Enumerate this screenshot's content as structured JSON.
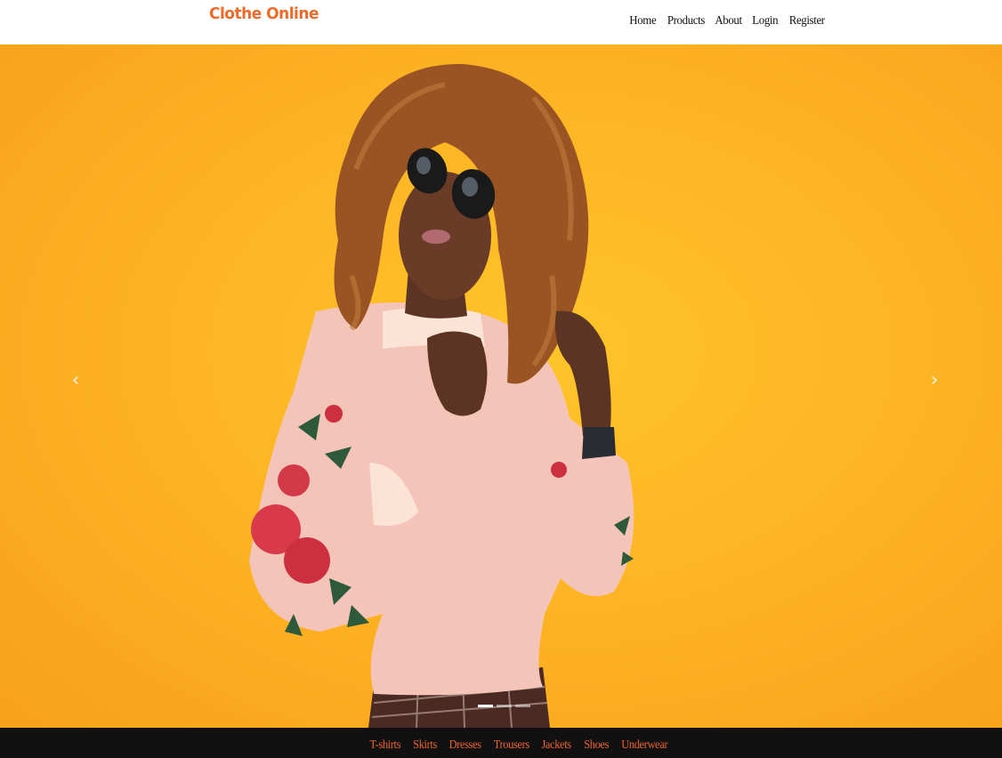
{
  "header": {
    "brand": "Clothe Online",
    "nav": [
      "Home",
      "Products",
      "About",
      "Login",
      "Register"
    ]
  },
  "carousel": {
    "image_description": "woman with curly hair and sunglasses wearing a pink sweater with rose embroidery against a yellow background",
    "prev_icon": "‹",
    "next_icon": "›",
    "indicator_count": 3,
    "active_index": 0
  },
  "categories": [
    "T-shirts",
    "Skirts",
    "Dresses",
    "Trousers",
    "Jackets",
    "Shoes",
    "Underwear"
  ],
  "colors": {
    "brand": "#f06a2a",
    "category_text": "#f0622e",
    "category_bar": "#111111",
    "hero_background": "#fdb524"
  }
}
